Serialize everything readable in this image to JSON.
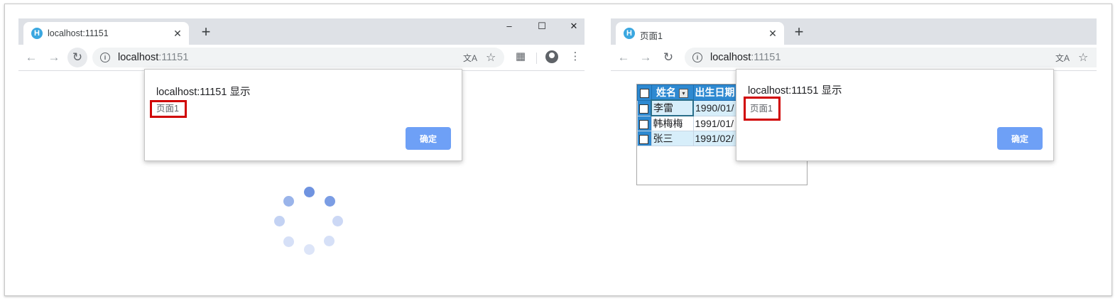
{
  "left_window": {
    "tab_title": "localhost:11151",
    "favicon_letter": "H",
    "url_host": "localhost",
    "url_port": ":11151",
    "dialog": {
      "title": "localhost:11151 显示",
      "message": "页面1",
      "ok_label": "确定"
    },
    "window_controls": {
      "minimize": "–",
      "maximize": "☐",
      "close": "✕"
    }
  },
  "right_window": {
    "tab_title": "页面1",
    "favicon_letter": "H",
    "url_host": "localhost",
    "url_port": ":11151",
    "dialog": {
      "title": "localhost:11151 显示",
      "message": "页面1",
      "ok_label": "确定"
    },
    "grid": {
      "columns": [
        "姓名",
        "出生日期"
      ],
      "rows": [
        [
          "李雷",
          "1990/01/"
        ],
        [
          "韩梅梅",
          "1991/01/"
        ],
        [
          "张三",
          "1991/02/"
        ]
      ]
    }
  },
  "icons": {
    "back": "arrow-left-icon",
    "forward": "arrow-right-icon",
    "reload": "reload-icon",
    "info": "info-icon",
    "translate": "translate-icon",
    "star": "star-icon",
    "qr": "qr-code-icon",
    "account": "account-icon",
    "menu": "kebab-menu-icon",
    "new_tab": "plus-icon",
    "close_tab": "close-icon",
    "spinner": "loading-spinner-icon"
  },
  "colors": {
    "accent_button": "#6ea0f6",
    "highlight_box": "#d00000",
    "grid_header": "#2e89d1",
    "grid_row_alt": "#d7eefa",
    "spinner": "#6f93e0"
  }
}
